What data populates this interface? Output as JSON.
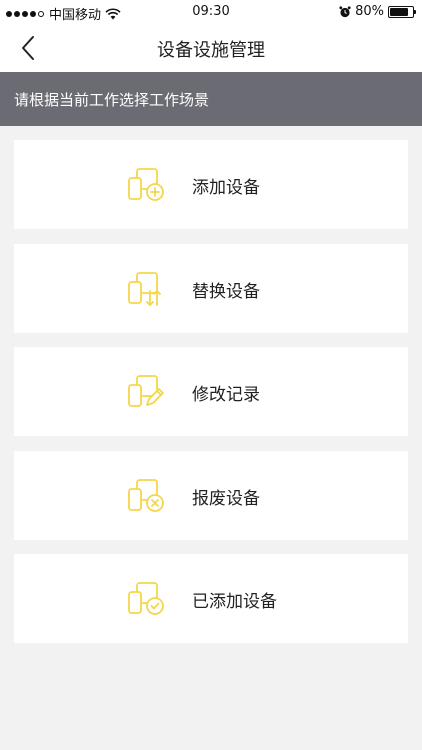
{
  "status_bar": {
    "carrier": "中国移动",
    "time": "09:30",
    "battery": "80%",
    "battery_level": 0.8
  },
  "nav": {
    "title": "设备设施管理",
    "back_icon": "chevron-left-icon"
  },
  "hint": "请根据当前工作选择工作场景",
  "accent_color": "#f5d64a",
  "cards": [
    {
      "label": "添加设备",
      "icon": "add-device-icon"
    },
    {
      "label": "替换设备",
      "icon": "replace-device-icon"
    },
    {
      "label": "修改记录",
      "icon": "edit-record-icon"
    },
    {
      "label": "报废设备",
      "icon": "scrap-device-icon"
    },
    {
      "label": "已添加设备",
      "icon": "added-device-icon"
    }
  ]
}
